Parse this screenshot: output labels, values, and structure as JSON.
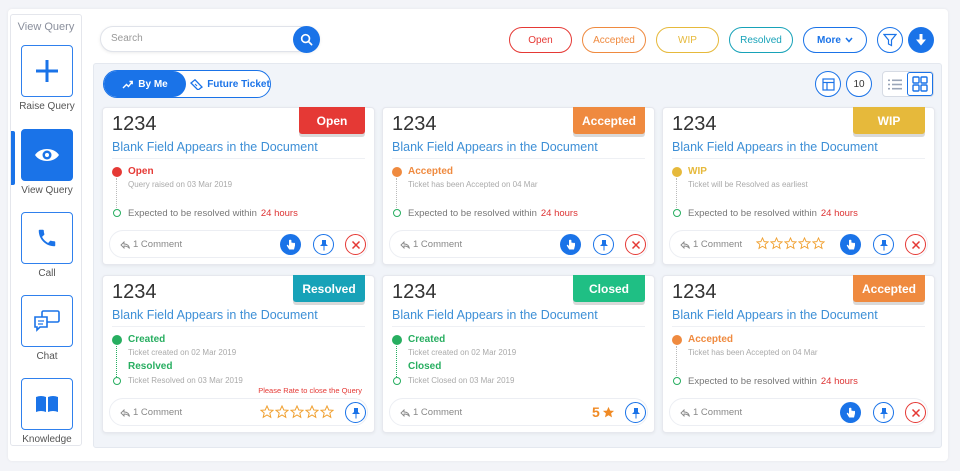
{
  "sidebar": {
    "title": "View Query",
    "items": [
      {
        "label": "Raise Query",
        "icon": "plus-icon"
      },
      {
        "label": "View Query",
        "icon": "eye-icon",
        "active": true
      },
      {
        "label": "Call",
        "icon": "phone-icon"
      },
      {
        "label": "Chat",
        "icon": "chat-icon"
      },
      {
        "label": "Knowledge",
        "icon": "book-icon"
      }
    ]
  },
  "search": {
    "placeholder": "Search",
    "value": ""
  },
  "filters": [
    {
      "label": "Open",
      "color": "#e53935"
    },
    {
      "label": "Accepted",
      "color": "#ef8a3f"
    },
    {
      "label": "WIP",
      "color": "#e6b93b"
    },
    {
      "label": "Resolved",
      "color": "#17a2b8"
    },
    {
      "label": "More",
      "color": "#1a73e8"
    }
  ],
  "toolbar": {
    "by_me": "By Me",
    "future_ticket": "Future Ticket",
    "count": "10"
  },
  "colors": {
    "primary": "#1a73e8",
    "open": "#e53935",
    "accepted": "#ef8a3f",
    "wip": "#e6b93b",
    "resolved": "#17a2b8",
    "closed": "#1fbf84",
    "created": "#27ae60"
  },
  "cards": [
    {
      "id": "1234",
      "status": "Open",
      "title": "Blank Field Appears in the Document",
      "event_label": "Open",
      "event_sub": "Query raised on 03 Mar 2019",
      "expected": "Expected to be resolved within",
      "expected_time": "24 hours",
      "comments": "1 Comment"
    },
    {
      "id": "1234",
      "status": "Accepted",
      "title": "Blank Field Appears in the Document",
      "event_label": "Accepted",
      "event_sub": "Ticket has been Accepted on 04 Mar",
      "expected": "Expected to be resolved within",
      "expected_time": "24 hours",
      "comments": "1 Comment"
    },
    {
      "id": "1234",
      "status": "WIP",
      "title": "Blank Field Appears in the Document",
      "event_label": "WIP",
      "event_sub": "Ticket will be Resolved as earliest",
      "expected": "Expected to be resolved within",
      "expected_time": "24 hours",
      "comments": "1 Comment"
    },
    {
      "id": "1234",
      "status": "Resolved",
      "title": "Blank Field Appears in the Document",
      "event_label": "Created",
      "event_sub": "Ticket created on 02 Mar 2019",
      "event2_label": "Resolved",
      "event2_sub": "Ticket Resolved on 03 Mar 2019",
      "rate_note": "Please Rate to close the Query",
      "comments": "1 Comment"
    },
    {
      "id": "1234",
      "status": "Closed",
      "title": "Blank Field Appears in the Document",
      "event_label": "Created",
      "event_sub": "Ticket created on 02 Mar 2019",
      "event2_label": "Closed",
      "event2_sub": "Ticket Closed on 03 Mar 2019",
      "rating": "5",
      "comments": "1 Comment"
    },
    {
      "id": "1234",
      "status": "Accepted",
      "title": "Blank Field Appears in the Document",
      "event_label": "Accepted",
      "event_sub": "Ticket has been Accepted on 04 Mar",
      "expected": "Expected to be resolved within",
      "expected_time": "24 hours",
      "comments": "1 Comment"
    }
  ]
}
